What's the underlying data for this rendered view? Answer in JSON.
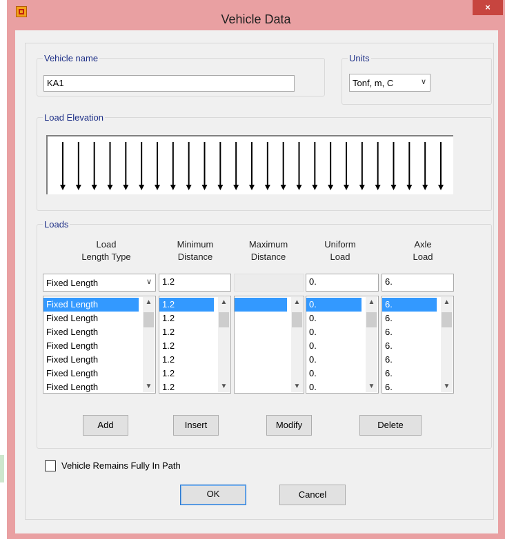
{
  "window": {
    "title": "Vehicle Data",
    "close_glyph": "×"
  },
  "vehicle_name": {
    "label": "Vehicle name",
    "value": "KA1"
  },
  "units": {
    "label": "Units",
    "value": "Tonf, m, C"
  },
  "load_elevation": {
    "label": "Load Elevation",
    "arrow_count": 25
  },
  "loads": {
    "label": "Loads",
    "headers": {
      "type": [
        "Load",
        "Length Type"
      ],
      "min": [
        "Minimum",
        "Distance"
      ],
      "max": [
        "Maximum",
        "Distance"
      ],
      "uniform": [
        "Uniform",
        "Load"
      ],
      "axle": [
        "Axle",
        "Load"
      ]
    },
    "edit_row": {
      "type": "Fixed Length",
      "min": "1.2",
      "max": "",
      "uniform": "0.",
      "axle": "6."
    },
    "list": {
      "type": [
        "Fixed Length",
        "Fixed Length",
        "Fixed Length",
        "Fixed Length",
        "Fixed Length",
        "Fixed Length",
        "Fixed Length"
      ],
      "min": [
        "1.2",
        "1.2",
        "1.2",
        "1.2",
        "1.2",
        "1.2",
        "1.2"
      ],
      "max": [
        "",
        "",
        "",
        "",
        "",
        "",
        ""
      ],
      "uniform": [
        "0.",
        "0.",
        "0.",
        "0.",
        "0.",
        "0.",
        "0."
      ],
      "axle": [
        "6.",
        "6.",
        "6.",
        "6.",
        "6.",
        "6.",
        "6."
      ]
    },
    "buttons": {
      "add": "Add",
      "insert": "Insert",
      "modify": "Modify",
      "delete": "Delete"
    }
  },
  "remains_in_path": {
    "label": "Vehicle Remains Fully In Path",
    "checked": false
  },
  "dialog_buttons": {
    "ok": "OK",
    "cancel": "Cancel"
  },
  "colors": {
    "title_bar": "#e9a0a2",
    "close_button": "#c7453f",
    "selection": "#3399ff",
    "group_label": "#1d2f87"
  }
}
